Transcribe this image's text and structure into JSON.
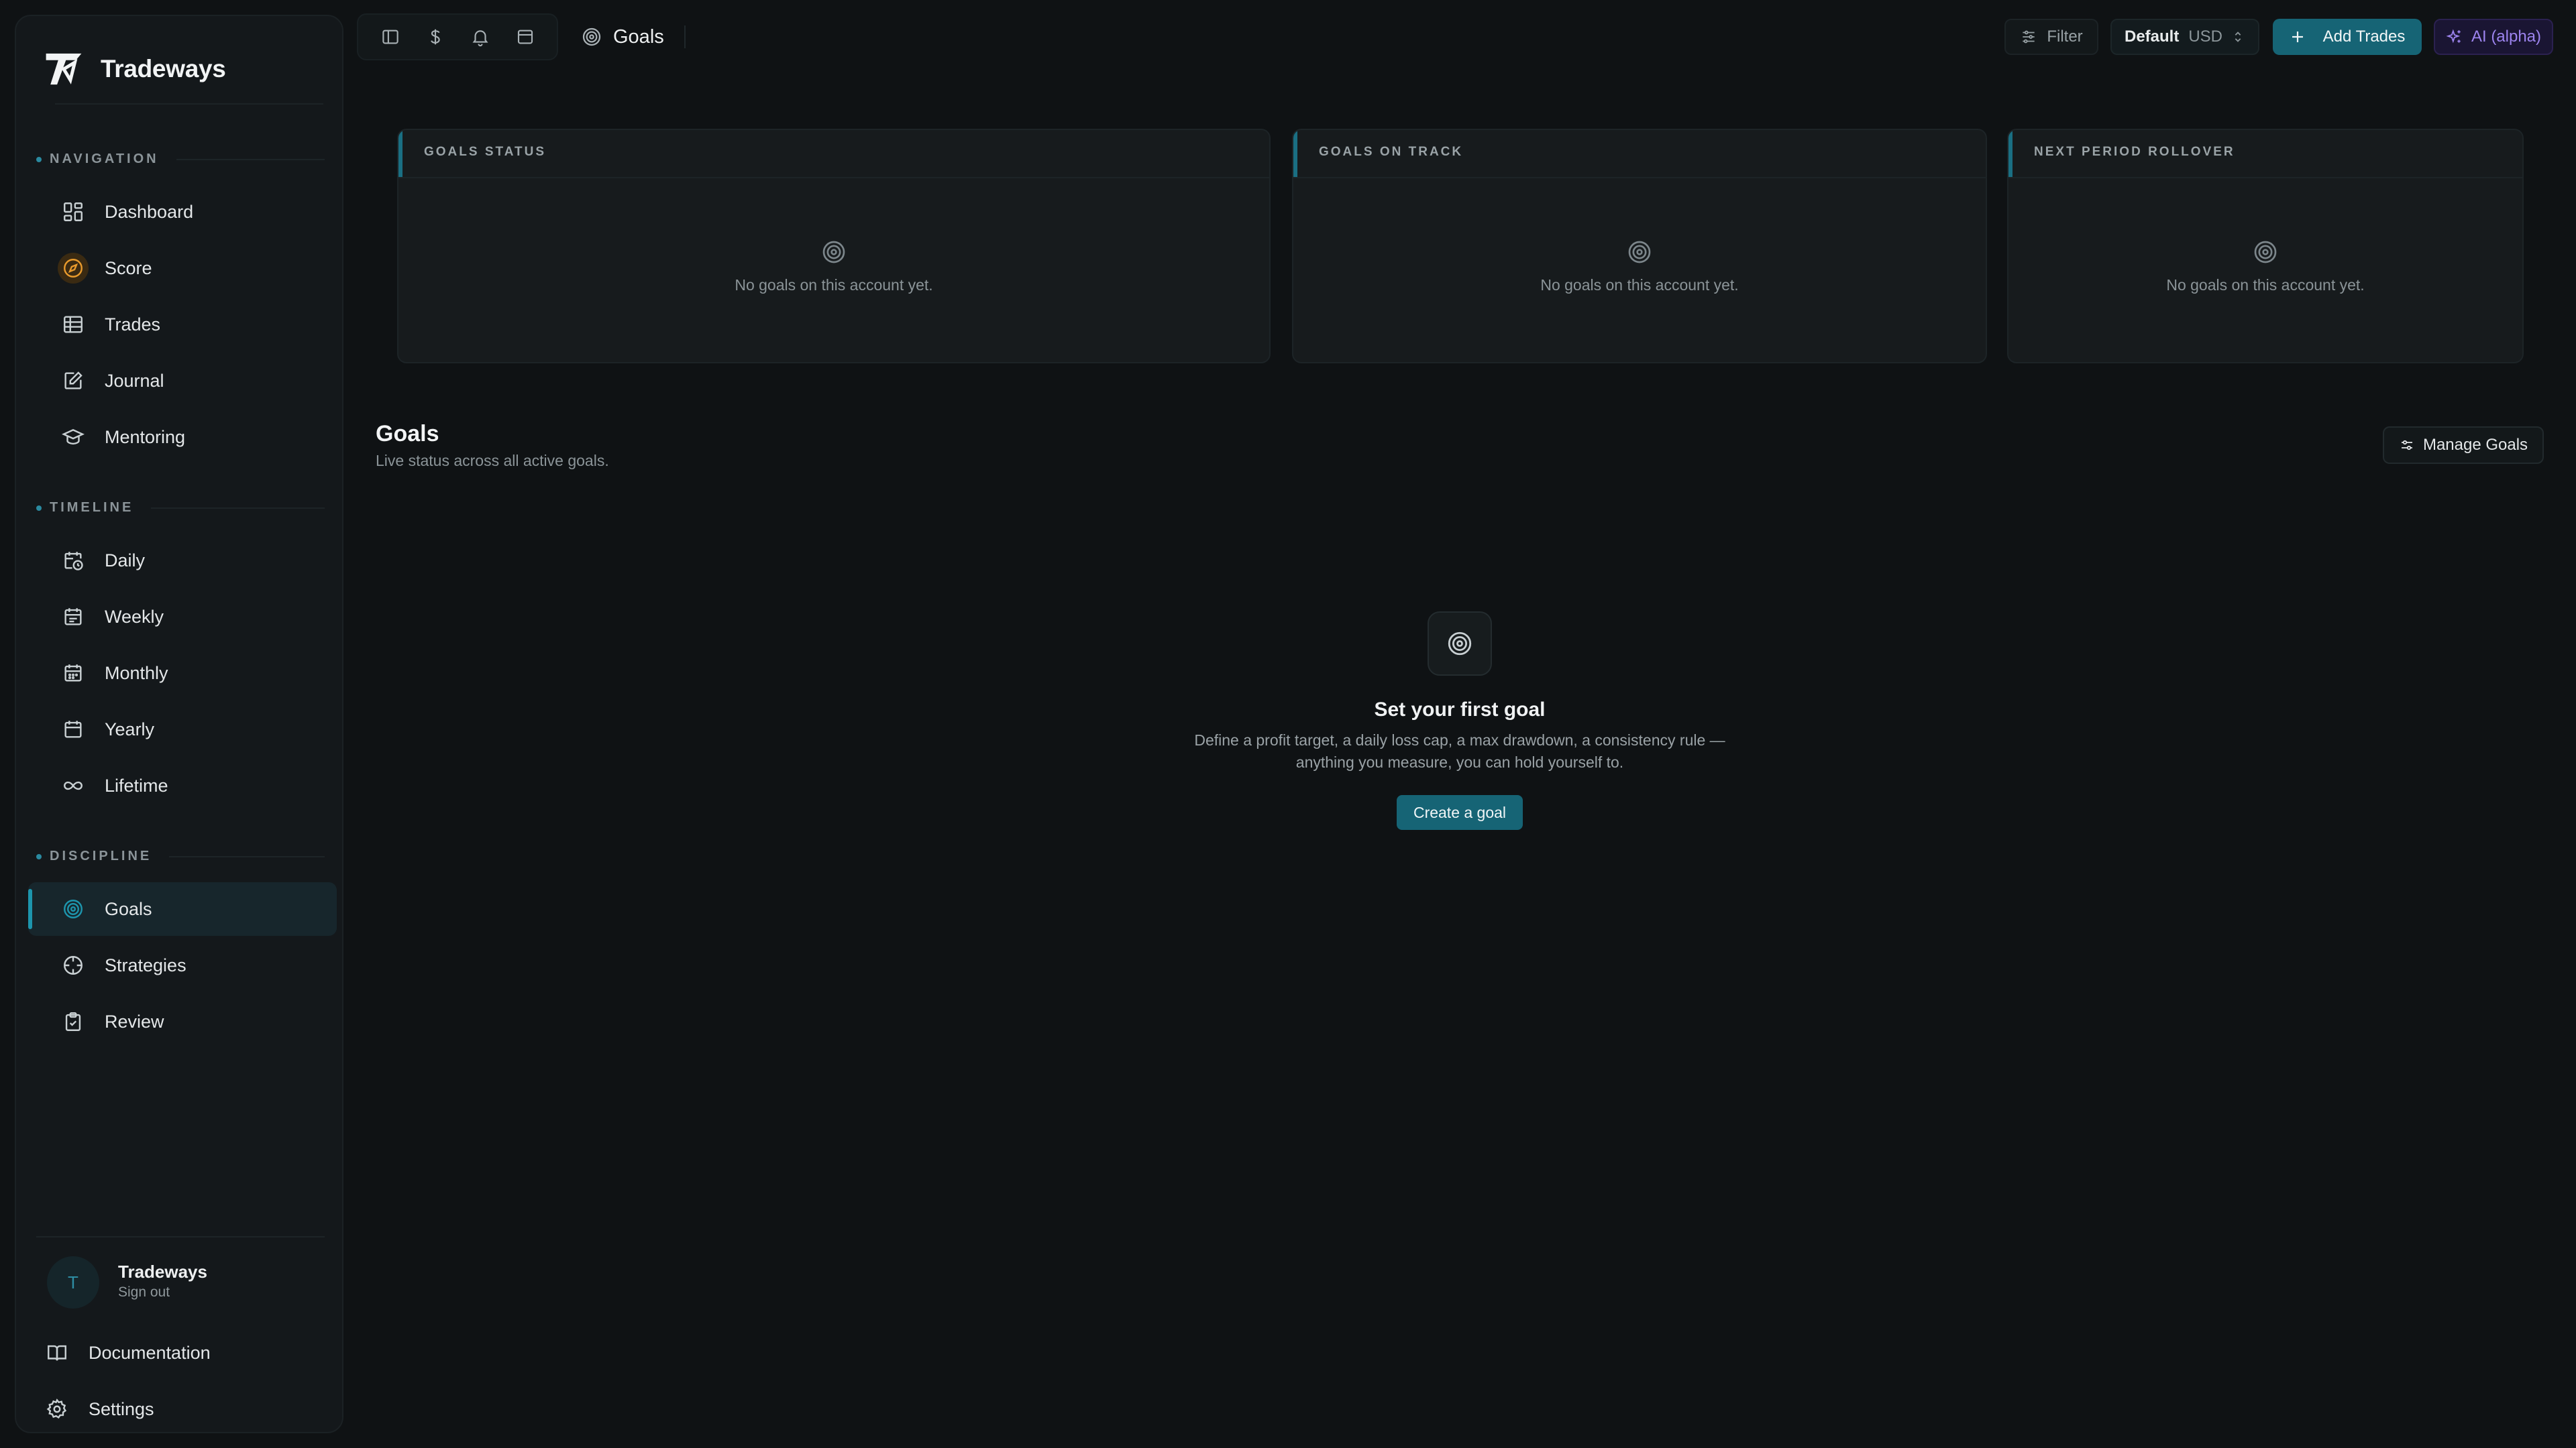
{
  "brand": {
    "name": "Tradeways"
  },
  "sidebar": {
    "sections": {
      "navigation": "NAVIGATION",
      "timeline": "TIMELINE",
      "discipline": "DISCIPLINE"
    },
    "items": {
      "dashboard": "Dashboard",
      "score": "Score",
      "trades": "Trades",
      "journal": "Journal",
      "mentoring": "Mentoring",
      "daily": "Daily",
      "weekly": "Weekly",
      "monthly": "Monthly",
      "yearly": "Yearly",
      "lifetime": "Lifetime",
      "goals": "Goals",
      "strategies": "Strategies",
      "review": "Review"
    },
    "active_item": "goals",
    "user": {
      "initial": "T",
      "name": "Tradeways",
      "action": "Sign out"
    },
    "bottom": {
      "documentation": "Documentation",
      "settings": "Settings"
    }
  },
  "topbar": {
    "page_title": "Goals",
    "filter_label": "Filter",
    "account": {
      "name": "Default",
      "currency": "USD"
    },
    "add_trades_label": "Add Trades",
    "ai_label": "AI (alpha)"
  },
  "stats": {
    "goals_status": {
      "title": "GOALS STATUS",
      "empty": "No goals on this account yet."
    },
    "goals_on_track": {
      "title": "GOALS ON TRACK",
      "empty": "No goals on this account yet."
    },
    "next_rollover": {
      "title": "NEXT PERIOD ROLLOVER",
      "empty": "No goals on this account yet."
    }
  },
  "goals": {
    "title": "Goals",
    "subtitle": "Live status across all active goals.",
    "manage_label": "Manage Goals",
    "empty_state": {
      "title": "Set your first goal",
      "description_line1": "Define a profit target, a daily loss cap, a max drawdown, a consistency rule —",
      "description_line2": "anything you measure, you can hold yourself to.",
      "cta": "Create a goal"
    }
  },
  "colors": {
    "background": "#0f1214",
    "sidebar": "#14181b",
    "accent": "#166475",
    "accent_bright": "#1d95ad",
    "ai_purple": "#9d84ef",
    "score_orange": "#e89a2c"
  },
  "icons": {
    "logo": "tradeways-logo",
    "dashboard": "grid-icon",
    "score": "compass-icon",
    "trades": "table-icon",
    "journal": "edit-note-icon",
    "mentoring": "graduation-cap-icon",
    "daily": "calendar-clock-icon",
    "weekly": "calendar-icon",
    "monthly": "calendar-icon",
    "yearly": "calendar-icon",
    "lifetime": "infinity-icon",
    "goals": "target-icon",
    "strategies": "crosshair-icon",
    "review": "clipboard-check-icon",
    "documentation": "book-icon",
    "settings": "gear-icon"
  }
}
